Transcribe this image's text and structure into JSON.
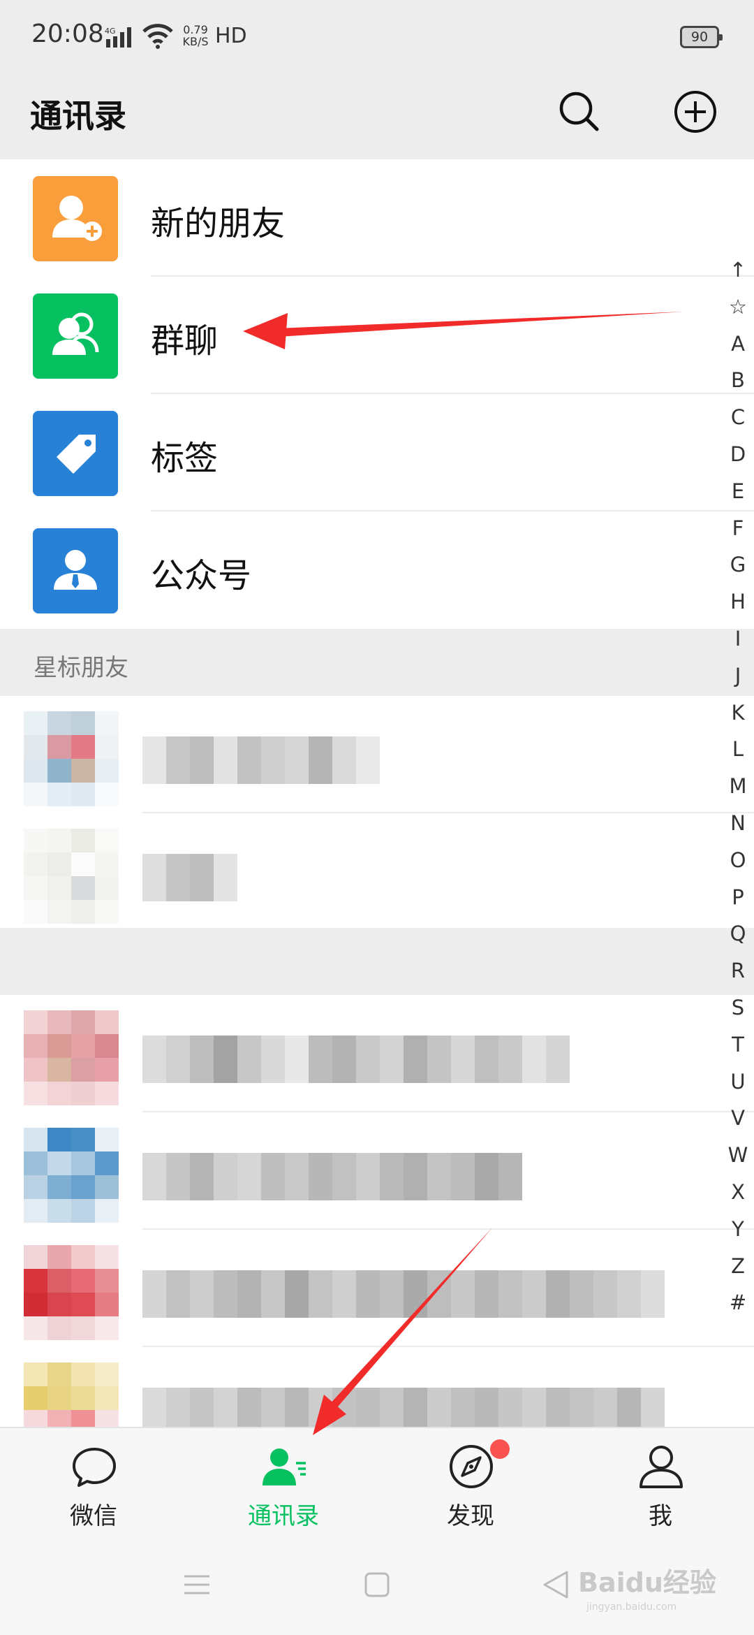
{
  "status_bar": {
    "time": "20:08",
    "network": "4G",
    "speed_value": "0.79",
    "speed_unit": "KB/S",
    "hd": "HD",
    "battery": "90"
  },
  "header": {
    "title": "通讯录",
    "search_icon": "search-icon",
    "add_icon": "plus-circle-icon"
  },
  "features": [
    {
      "label": "新的朋友",
      "icon": "add-friend-icon",
      "color": "#fa9d3b"
    },
    {
      "label": "群聊",
      "icon": "group-chat-icon",
      "color": "#07c160"
    },
    {
      "label": "标签",
      "icon": "tag-icon",
      "color": "#2782d7"
    },
    {
      "label": "公众号",
      "icon": "official-account-icon",
      "color": "#2782d7"
    }
  ],
  "starred_section": {
    "title": "星标朋友"
  },
  "alphabet_index": [
    "↑",
    "☆",
    "A",
    "B",
    "C",
    "D",
    "E",
    "F",
    "G",
    "H",
    "I",
    "J",
    "K",
    "L",
    "M",
    "N",
    "O",
    "P",
    "Q",
    "R",
    "S",
    "T",
    "U",
    "V",
    "W",
    "X",
    "Y",
    "Z",
    "#"
  ],
  "bottom_nav": [
    {
      "label": "微信",
      "icon": "chat-bubble-icon",
      "active": false
    },
    {
      "label": "通讯录",
      "icon": "contacts-icon",
      "active": true
    },
    {
      "label": "发现",
      "icon": "compass-icon",
      "active": false,
      "badge": true
    },
    {
      "label": "我",
      "icon": "person-icon",
      "active": false
    }
  ],
  "colors": {
    "accent": "#07c160",
    "annotation_arrow": "#f12a2a",
    "badge": "#fa5151"
  },
  "watermark": {
    "text": "Baidu经验",
    "sub": "jingyan.baidu.com"
  }
}
